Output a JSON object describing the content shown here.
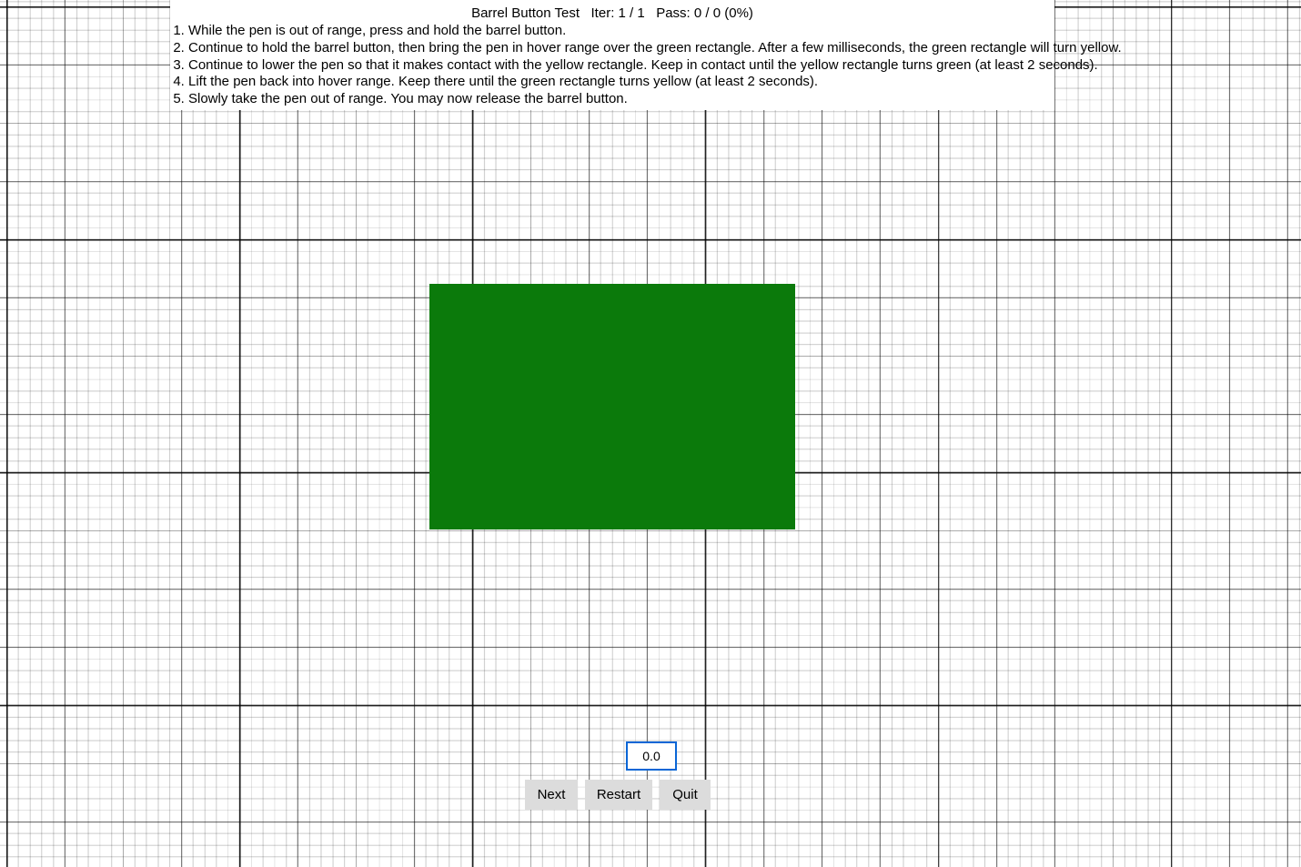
{
  "title": "Barrel Button Test   Iter: 1 / 1   Pass: 0 / 0 (0%)",
  "instructions": [
    "While the pen is out of range, press and hold the barrel button.",
    "Continue to hold the barrel button, then bring the pen in hover range over the green rectangle. After a few milliseconds, the green rectangle will turn yellow.",
    "Continue to lower the pen so that it makes contact with the yellow rectangle. Keep in contact until the yellow rectangle turns green (at least 2 seconds).",
    "Lift the pen back into hover range. Keep there until the green rectangle turns yellow (at least 2 seconds).",
    "Slowly take the pen out of range. You may now release the barrel button."
  ],
  "target": {
    "color": "#0b7a0b"
  },
  "readout": {
    "value": "0.0"
  },
  "buttons": {
    "next": "Next",
    "restart": "Restart",
    "quit": "Quit"
  }
}
